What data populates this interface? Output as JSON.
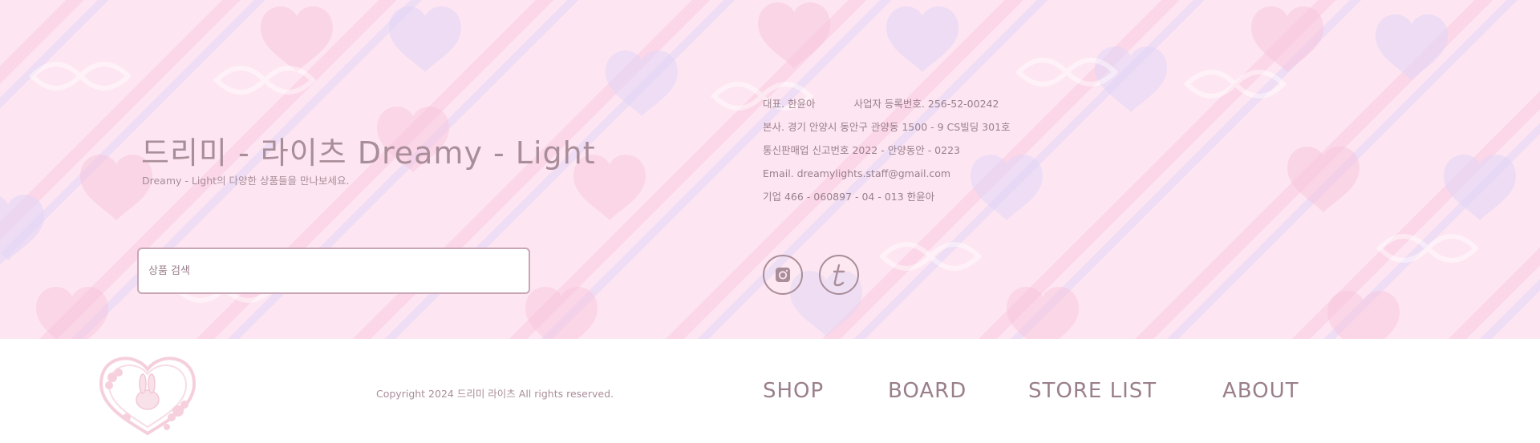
{
  "brand": {
    "title": "드리미 - 라이츠 Dreamy - Light",
    "subtitle": "Dreamy - Light의 다양한 상품들을 만나보세요."
  },
  "search": {
    "placeholder": "상품 검색",
    "value": ""
  },
  "company_info": {
    "representative": "대표. 한윤아",
    "business_number": "사업자 등록번호. 256-52-00242",
    "address": "본사. 경기 안양시 동안구 관양동 1500 - 9 CS빌딩 301호",
    "mail_order_number": "통신판매업 신고번호 2022 - 안양동안 - 0223",
    "email": "Email. dreamylights.staff@gmail.com",
    "account": "기업 466 - 060897 - 04 - 013 한윤아"
  },
  "social": {
    "instagram_icon": "instagram-icon",
    "tumblr_icon": "tumblr-icon"
  },
  "footer": {
    "logo_icon": "bunny-heart-logo",
    "copyright": "Copyright 2024 드리미 라이츠 All rights reserved.",
    "nav": {
      "shop": "SHOP",
      "board": "BOARD",
      "store_list": "STORE LIST",
      "about": "ABOUT"
    }
  },
  "colors": {
    "background_pink": "#fde6f1",
    "text_mauve": "#9a7f8b",
    "stripe_pink": "#f8c4dc",
    "stripe_lavender": "#e2d6f6"
  }
}
